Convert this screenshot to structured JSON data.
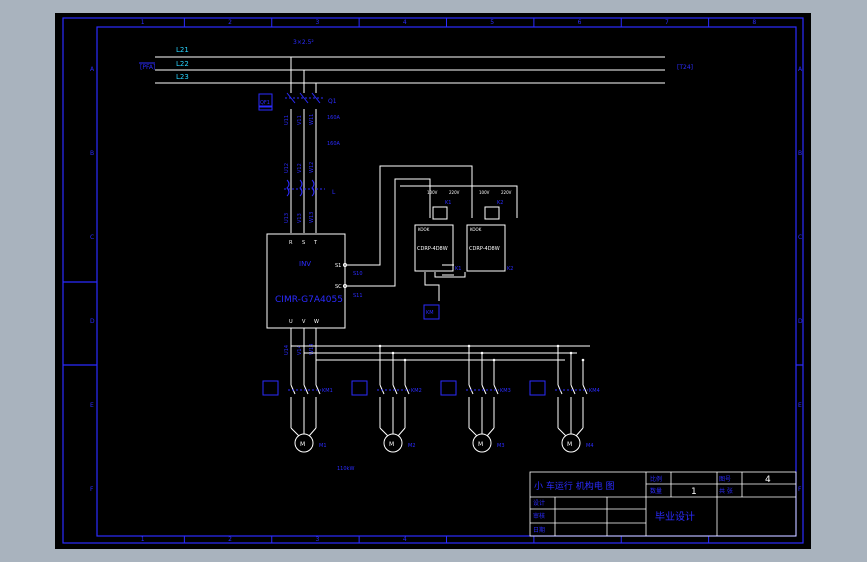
{
  "colors": {
    "background": "#000000",
    "frame": "#2b2bff",
    "cyan": "#2ad4ff",
    "white": "#ffffff",
    "canvas_outer": "#a9b3be"
  },
  "border": {
    "columns": [
      "1",
      "2",
      "3",
      "4",
      "5",
      "6",
      "7",
      "8"
    ],
    "rows": [
      "A",
      "B",
      "C",
      "D",
      "E",
      "F"
    ]
  },
  "bus": {
    "top_label": "3×2.5²",
    "left_tag": "[PFA]",
    "right_tag": "[T24]",
    "lines": [
      "L21",
      "L22",
      "L23"
    ]
  },
  "main_circuit": {
    "breaker_tag": "QF1",
    "breaker_label": "Q1",
    "breaker_rating": "160A",
    "contactor_label": "160A",
    "reactor_label": "L",
    "wire_labels": [
      "U11",
      "V11",
      "W11",
      "U12",
      "V12",
      "W12",
      "U13",
      "V13",
      "W13",
      "U14",
      "V14",
      "W14"
    ]
  },
  "inverter": {
    "title": "INV",
    "model": "CIMR-G7A4055",
    "input_terminals": [
      "R",
      "S",
      "T"
    ],
    "output_terminals": [
      "U",
      "V",
      "W"
    ],
    "control_terminals": [
      "S1",
      "SC"
    ],
    "control_wires": [
      "S10",
      "S11"
    ]
  },
  "relays": [
    {
      "model": "CDRP-4D8W",
      "label": "K1",
      "coil": "KOOK",
      "ratings": [
        "100V",
        "220V"
      ]
    },
    {
      "model": "CDRP-4D8W",
      "label": "K2",
      "coil": "KOOK",
      "ratings": [
        "100V",
        "220V"
      ]
    }
  ],
  "relay_bottom_tag": "KM",
  "motors": [
    {
      "label": "M1",
      "contactor": "KM1"
    },
    {
      "label": "M2",
      "contactor": "KM2"
    },
    {
      "label": "M3",
      "contactor": "KM3"
    },
    {
      "label": "M4",
      "contactor": "KM4"
    }
  ],
  "motor_rating": "110kW",
  "title_block": {
    "title": "小 车运行 机构电 图",
    "row_labels": [
      "设计",
      "审核",
      "日期"
    ],
    "cells": {
      "ratio_label": "比例",
      "qty_label": "数量",
      "qty_value": "1",
      "sheet_label": "图号",
      "sheet_value": "4",
      "sheet_label2": "共 张"
    },
    "subtitle": "毕业设计"
  }
}
